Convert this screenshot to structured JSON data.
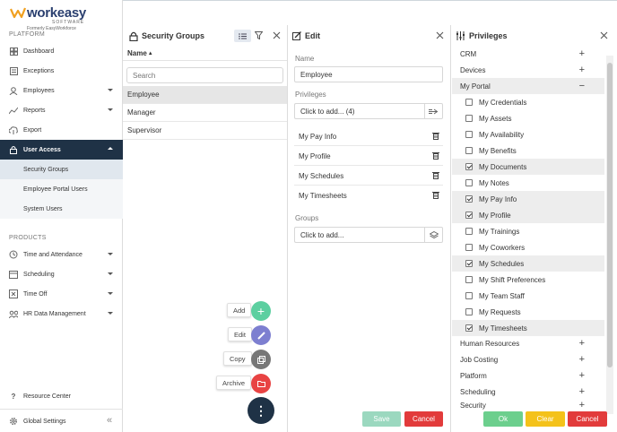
{
  "brand": {
    "name": "workeasy",
    "sub": "SOFTWARE",
    "formerly": "Formerly EasyWorkforce"
  },
  "sidebar": {
    "platform_label": "PLATFORM",
    "platform_items": [
      {
        "label": "Dashboard",
        "icon": "dashboard-icon"
      },
      {
        "label": "Exceptions",
        "icon": "exceptions-icon"
      },
      {
        "label": "Employees",
        "icon": "employees-icon"
      },
      {
        "label": "Reports",
        "icon": "reports-icon"
      },
      {
        "label": "Export",
        "icon": "export-icon"
      },
      {
        "label": "User Access",
        "icon": "user-access-icon"
      }
    ],
    "user_access_sub": [
      "Security Groups",
      "Employee Portal Users",
      "System Users"
    ],
    "products_label": "PRODUCTS",
    "product_items": [
      {
        "label": "Time and Attendance",
        "icon": "clock-icon"
      },
      {
        "label": "Scheduling",
        "icon": "calendar-icon"
      },
      {
        "label": "Time Off",
        "icon": "time-off-icon"
      },
      {
        "label": "HR Data Management",
        "icon": "hr-icon"
      }
    ],
    "resource_center": "Resource Center",
    "global_settings": "Global Settings"
  },
  "groups_panel": {
    "title": "Security Groups",
    "column": "Name",
    "search_placeholder": "Search",
    "rows": [
      "Employee",
      "Manager",
      "Supervisor"
    ]
  },
  "fab_menu": {
    "add": "Add",
    "edit": "Edit",
    "copy": "Copy",
    "archive": "Archive"
  },
  "edit_panel": {
    "title": "Edit",
    "name_label": "Name",
    "name_value": "Employee",
    "privileges_label": "Privileges",
    "privileges_add": "Click to add... (4)",
    "privileges": [
      "My Pay Info",
      "My Profile",
      "My Schedules",
      "My Timesheets"
    ],
    "groups_label": "Groups",
    "groups_add": "Click to add...",
    "save": "Save",
    "cancel": "Cancel"
  },
  "privileges_panel": {
    "title": "Privileges",
    "top_categories": [
      "CRM",
      "Devices"
    ],
    "open_category": "My Portal",
    "items": [
      {
        "label": "My Credentials",
        "checked": false
      },
      {
        "label": "My Assets",
        "checked": false
      },
      {
        "label": "My Availability",
        "checked": false
      },
      {
        "label": "My Benefits",
        "checked": false
      },
      {
        "label": "My Documents",
        "checked": true
      },
      {
        "label": "My Notes",
        "checked": false
      },
      {
        "label": "My Pay Info",
        "checked": true
      },
      {
        "label": "My Profile",
        "checked": true
      },
      {
        "label": "My Trainings",
        "checked": false
      },
      {
        "label": "My Coworkers",
        "checked": false
      },
      {
        "label": "My Schedules",
        "checked": true
      },
      {
        "label": "My Shift Preferences",
        "checked": false
      },
      {
        "label": "My Team Staff",
        "checked": false
      },
      {
        "label": "My Requests",
        "checked": false
      },
      {
        "label": "My Timesheets",
        "checked": true
      }
    ],
    "bottom_categories": [
      "Human Resources",
      "Job Costing",
      "Platform",
      "Scheduling",
      "Security"
    ],
    "ok": "Ok",
    "clear": "Clear",
    "cancel": "Cancel"
  },
  "colors": {
    "nav_active": "#1f3246",
    "add": "#5ccfa0",
    "edit": "#7d7fd0",
    "copy": "#777777",
    "archive": "#e84343",
    "save": "#9bd8bf",
    "cancel": "#e23b3b",
    "ok": "#6ccf8d",
    "clear": "#f4c21a"
  }
}
